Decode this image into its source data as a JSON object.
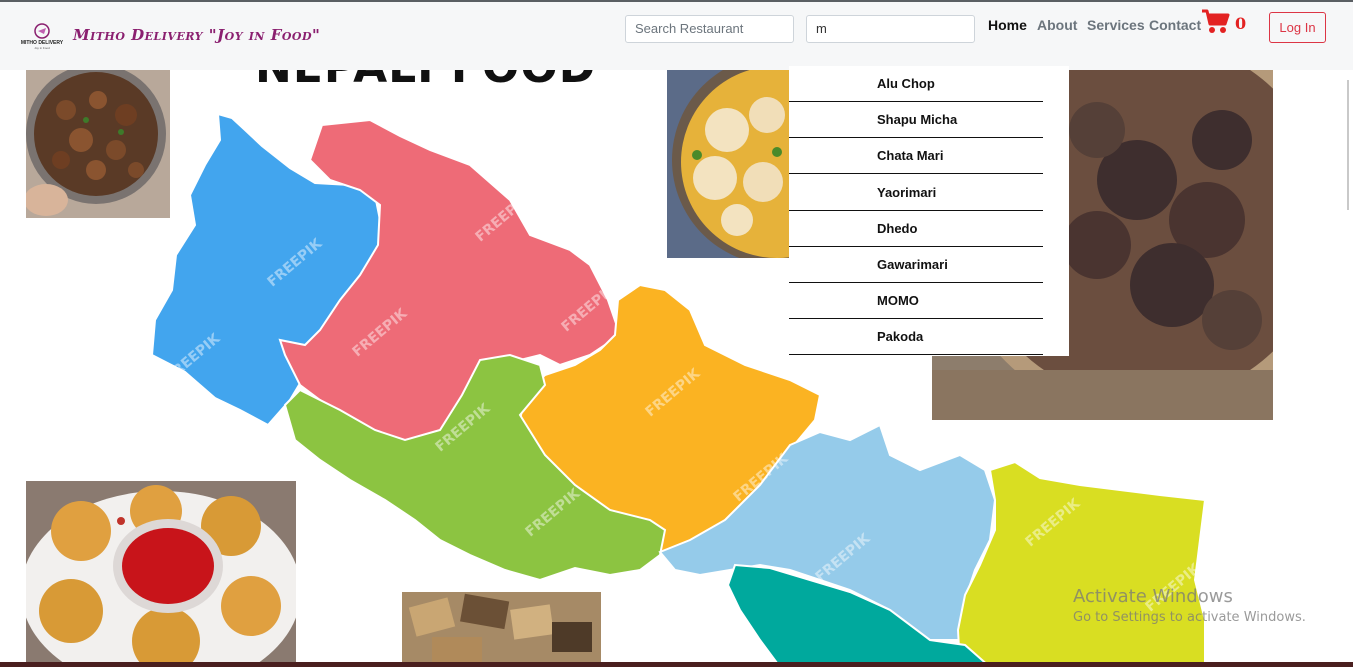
{
  "brand": {
    "logo_text": "MITHO DELIVERY",
    "logo_tagline": "Joy in Food",
    "name": "Mitho Delivery \"Joy in Food\""
  },
  "search": {
    "restaurant_placeholder": "Search Restaurant",
    "food_value": "m"
  },
  "nav": {
    "links": [
      "Home",
      "About",
      "Services",
      "Contact"
    ],
    "active": "Home",
    "cart_count": "0",
    "login_label": "Log In"
  },
  "page": {
    "title": "NEPALI FOOD",
    "watermark": "FREEPIK"
  },
  "dropdown": {
    "items": [
      "Alu Chop",
      "Shapu Micha",
      "Chata Mari",
      "Yaorimari",
      "Dhedo",
      "Gawarimari",
      "MOMO",
      "Pakoda"
    ]
  },
  "os_notice": {
    "title": "Activate Windows",
    "subtitle": "Go to Settings to activate Windows."
  },
  "colors": {
    "navbar_bg": "#f6f7f8",
    "brand": "#8a1f6f",
    "cart": "#e32222",
    "login": "#dc3545",
    "regions": [
      "#42a5ee",
      "#ee6b77",
      "#fbb322",
      "#8cc441",
      "#95cbea",
      "#d9de22",
      "#00a99d"
    ]
  }
}
